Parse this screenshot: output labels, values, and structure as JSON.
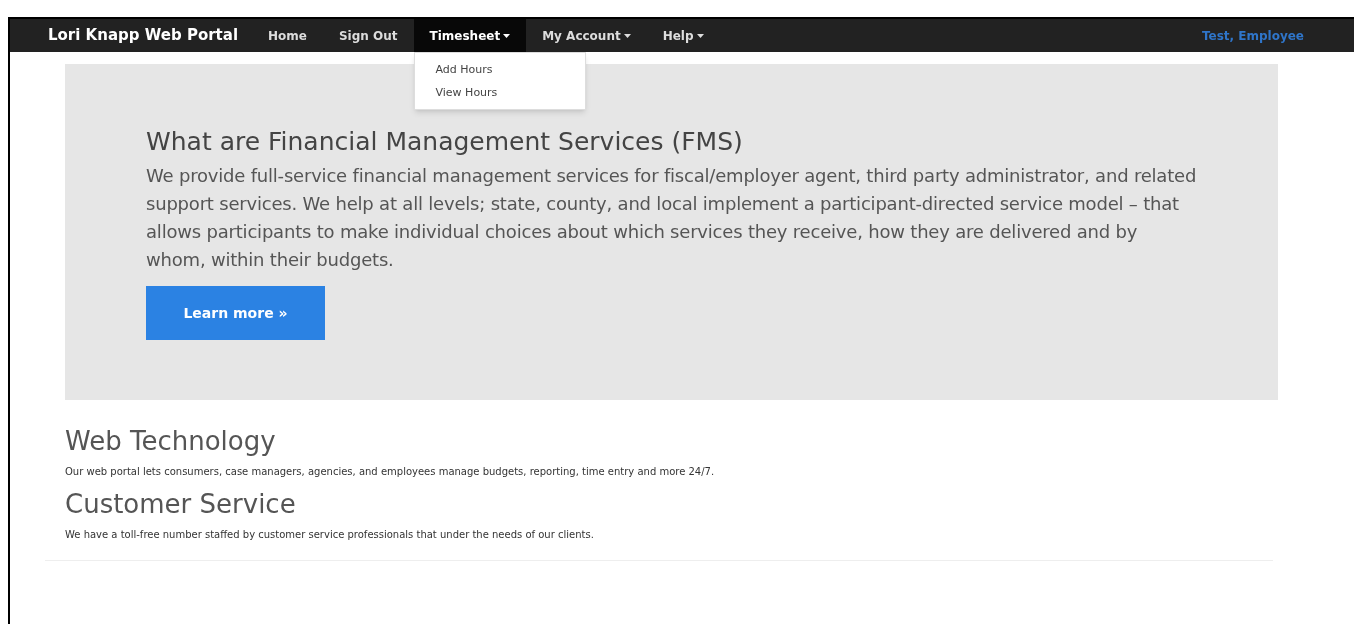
{
  "navbar": {
    "brand": "Lori Knapp Web Portal",
    "items": [
      {
        "label": "Home",
        "kind": "link",
        "expanded": false
      },
      {
        "label": "Sign Out",
        "kind": "link",
        "expanded": false
      },
      {
        "label": "Timesheet",
        "kind": "dropdown",
        "expanded": true,
        "menu": [
          "Add Hours",
          "View Hours"
        ]
      },
      {
        "label": "My Account",
        "kind": "dropdown",
        "expanded": false
      },
      {
        "label": "Help",
        "kind": "dropdown",
        "expanded": false
      }
    ],
    "user": "Test, Employee"
  },
  "hero": {
    "title": "What are Financial Management Services (FMS)",
    "text": "We provide full-service financial management services for fiscal/employer agent, third party administrator, and related support services. We help at all levels; state, county, and local implement a participant-directed service model – that allows participants to make individual choices about which services they receive, how they are delivered and by whom, within their budgets.",
    "button": "Learn more »"
  },
  "sections": [
    {
      "title": "Web Technology",
      "text": "Our web portal lets consumers, case managers, agencies, and employees manage budgets, reporting, time entry and more 24/7."
    },
    {
      "title": "Customer Service",
      "text": "We have a toll-free number staffed by customer service professionals that under the needs of our clients."
    }
  ]
}
